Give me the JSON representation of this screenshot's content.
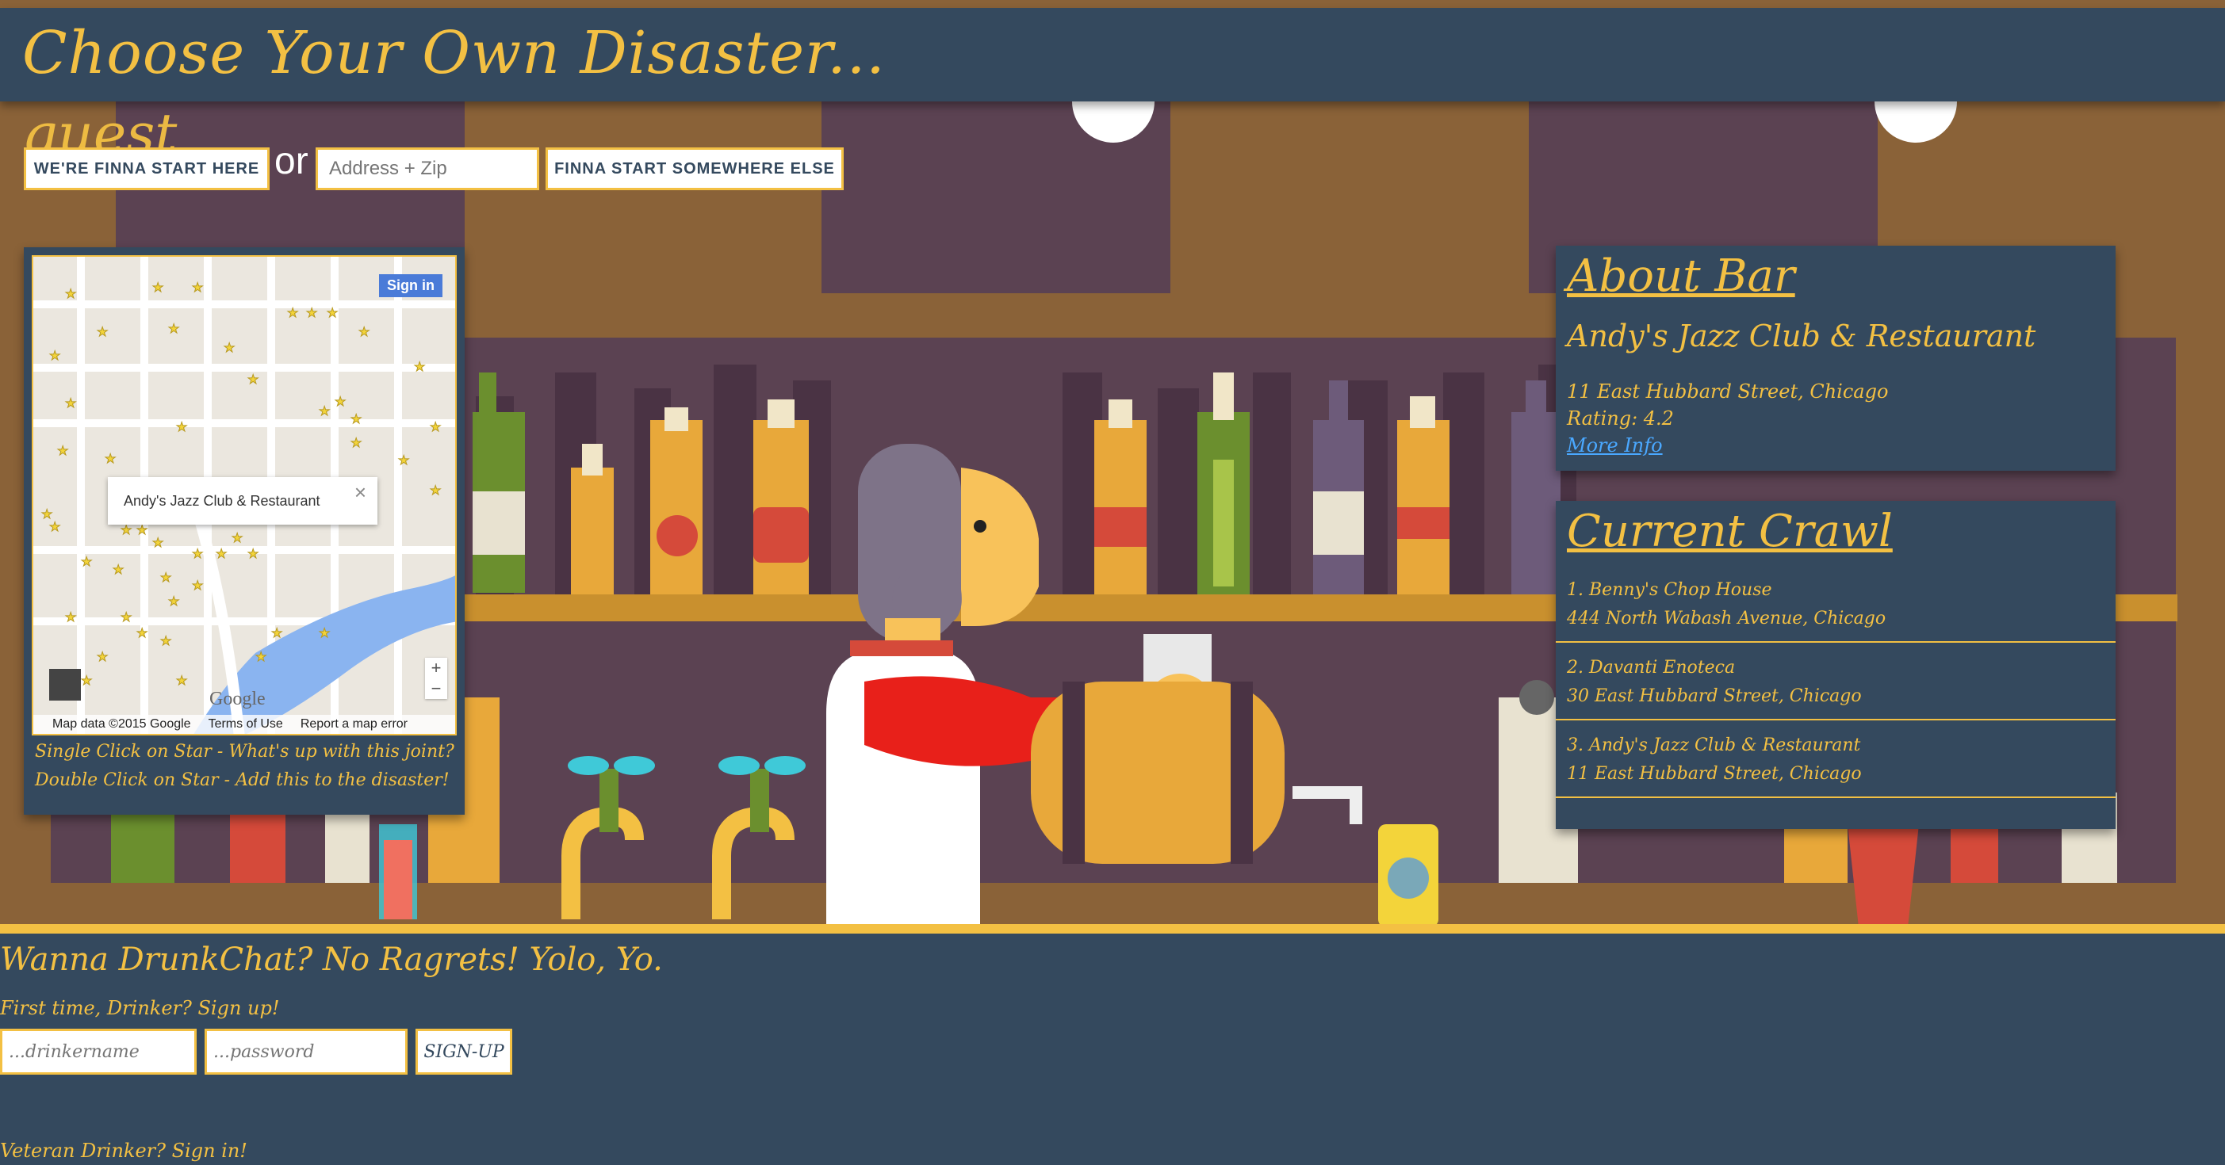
{
  "header": {
    "title": "Choose Your Own Disaster..."
  },
  "user": {
    "name": "guest"
  },
  "start_bar": {
    "start_here_label": "WE'RE FINNA START HERE",
    "or_label": "or",
    "address_placeholder": "Address + Zip",
    "start_else_label": "FINNA START SOMEWHERE ELSE"
  },
  "map": {
    "signin_label": "Sign in",
    "popup_title": "Andy's Jazz Club & Restaurant",
    "popup_close": "×",
    "logo": "Google",
    "attribution": "Map data ©2015 Google",
    "terms": "Terms of Use",
    "report": "Report a map error",
    "zoom_in": "+",
    "zoom_out": "−"
  },
  "map_tips": {
    "single": "Single Click on Star - What's up with this joint?",
    "double": "Double Click on Star - Add this to the disaster!"
  },
  "about_bar": {
    "heading": "About Bar",
    "name": "Andy's Jazz Club & Restaurant",
    "address": "11 East Hubbard Street, Chicago",
    "rating": "Rating: 4.2",
    "more_info": "More Info"
  },
  "crawl": {
    "heading": "Current Crawl",
    "items": [
      {
        "name": "1. Benny's Chop House",
        "address": "444 North Wabash Avenue, Chicago"
      },
      {
        "name": "2. Davanti Enoteca",
        "address": "30 East Hubbard Street, Chicago"
      },
      {
        "name": "3. Andy's Jazz Club & Restaurant",
        "address": "11 East Hubbard Street, Chicago"
      }
    ]
  },
  "chat": {
    "heading": "Wanna DrunkChat? No Ragrets! Yolo, Yo.",
    "signup_prompt": "First time, Drinker? Sign up!",
    "drinkername_placeholder": "...drinkername",
    "password_placeholder": "...password",
    "signup_label": "SIGN-UP",
    "signin_prompt": "Veteran Drinker? Sign in!"
  },
  "colors": {
    "accent": "#f3c043",
    "panel": "#34495e",
    "wall": "#8a6238",
    "shelf": "#5b4252"
  }
}
